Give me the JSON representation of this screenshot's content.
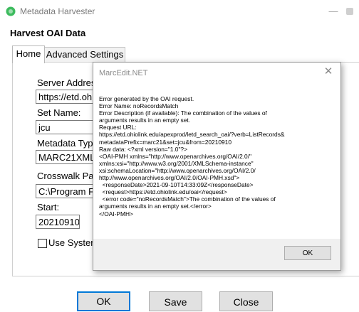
{
  "window": {
    "title": "Metadata Harvester",
    "minimize_glyph": "—",
    "icon_color": "#3dbb5e"
  },
  "heading": "Harvest OAI Data",
  "tabs": [
    {
      "label": "Home",
      "selected": true
    },
    {
      "label": "Advanced Settings",
      "selected": false
    }
  ],
  "form": {
    "server_address_label": "Server Addres",
    "server_address_value": "https://etd.ohio",
    "set_name_label": "Set Name:",
    "set_name_value": "jcu",
    "metadata_type_label": "Metadata Type",
    "metadata_type_value": "MARC21XML",
    "crosswalk_label": "Crosswalk Pa",
    "crosswalk_value": "C:\\Program F",
    "start_label": "Start:",
    "start_value": "20210910",
    "use_system_label": "Use Systen",
    "use_system_checked": false
  },
  "buttons": {
    "ok": "OK",
    "save": "Save",
    "close": "Close"
  },
  "dialog": {
    "title": "MarcEdit.NET",
    "close_glyph": "✕",
    "ok_label": "OK",
    "message": "Error generated by the OAI request.\nError Name: noRecordsMatch\nError Description (if available): The combination of the values of\narguments results in an empty set.\nRequest URL:\nhttps://etd.ohiolink.edu/apexprod/letd_search_oai/?verb=ListRecords&\nmetadataPrefix=marc21&set=jcu&from=20210910\nRaw data: <?xml version=\"1.0\"?>\n<OAI-PMH xmlns=\"http://www.openarchives.org/OAI/2.0/\"\nxmlns:xsi=\"http://www.w3.org/2001/XMLSchema-instance\"\nxsi:schemaLocation=\"http://www.openarchives.org/OAI/2.0/\nhttp://www.openarchives.org/OAI/2.0/OAI-PMH.xsd\">\n  <responseDate>2021-09-10T14:33:09Z</responseDate>\n  <request>https://etd.ohiolink.edu/oai</request>\n  <error code=\"noRecordsMatch\">The combination of the values of\narguments results in an empty set.</error>\n</OAI-PMH>"
  }
}
